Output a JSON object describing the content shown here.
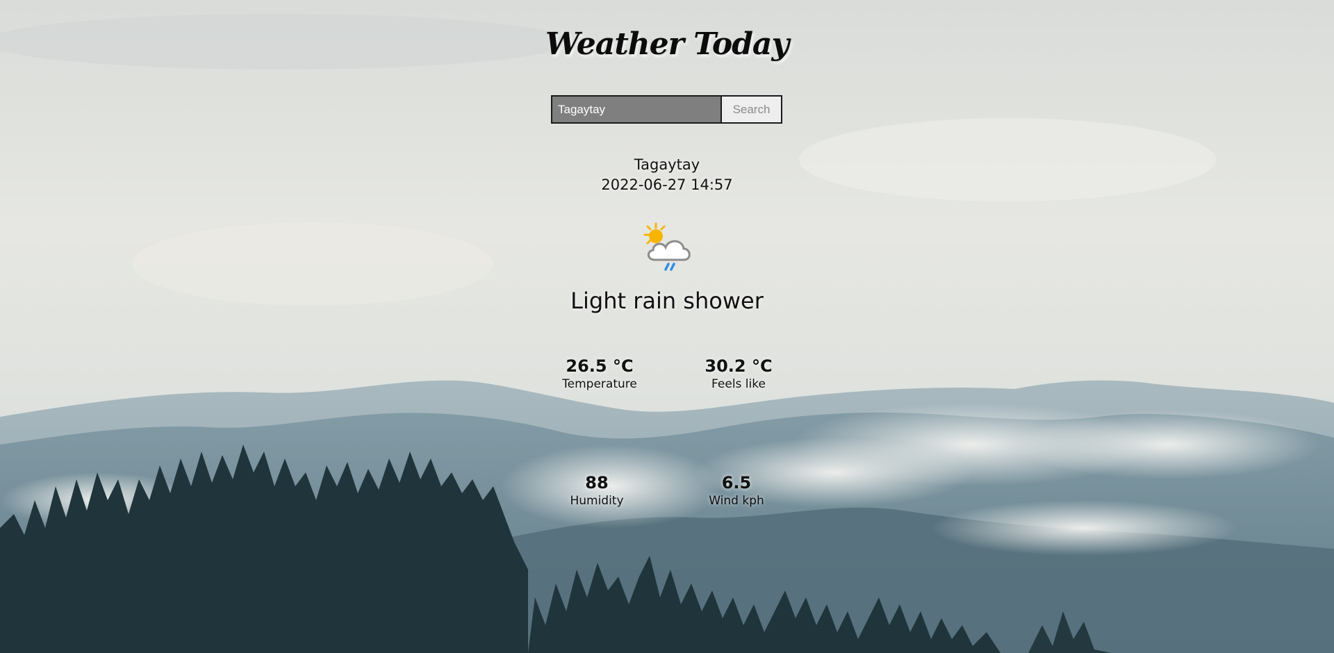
{
  "app": {
    "title": "Weather Today"
  },
  "search": {
    "value": "Tagaytay",
    "button_label": "Search"
  },
  "location": {
    "name": "Tagaytay",
    "datetime": "2022-06-27 14:57"
  },
  "condition": {
    "text": "Light rain shower",
    "icon": "partly-sunny-rain-icon"
  },
  "stats": {
    "temperature": {
      "value": "26.5 °C",
      "label": "Temperature"
    },
    "feels_like": {
      "value": "30.2 °C",
      "label": "Feels like"
    },
    "humidity": {
      "value": "88",
      "label": "Humidity"
    },
    "wind": {
      "value": "6.5",
      "label": "Wind kph"
    }
  },
  "colors": {
    "sky": "#e4e6e1",
    "mountain_far": "#8fa6b0",
    "mountain_near": "#5f7d8a",
    "trees": "#1f343b",
    "sun": "#f7b500",
    "rain": "#2a8ee8"
  }
}
